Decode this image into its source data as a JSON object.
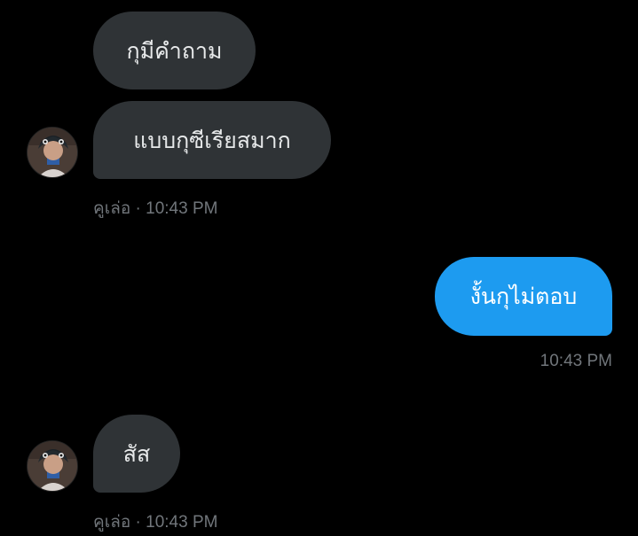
{
  "conversation": {
    "messages": [
      {
        "text": "กุมีคำถาม"
      },
      {
        "text": "แบบกุซีเรียสมาก"
      },
      {
        "meta": "คูเล่อ · 10:43 PM"
      },
      {
        "text": "งั้นกุไม่ตอบ"
      },
      {
        "meta": "10:43 PM"
      },
      {
        "text": "สัส"
      },
      {
        "meta": "คูเล่อ · 10:43 PM"
      }
    ]
  },
  "colors": {
    "background": "#000000",
    "received_bubble": "#2f3336",
    "sent_bubble": "#1d9bf0",
    "meta_text": "#71767b"
  },
  "icons": {
    "avatar": "user-avatar"
  }
}
